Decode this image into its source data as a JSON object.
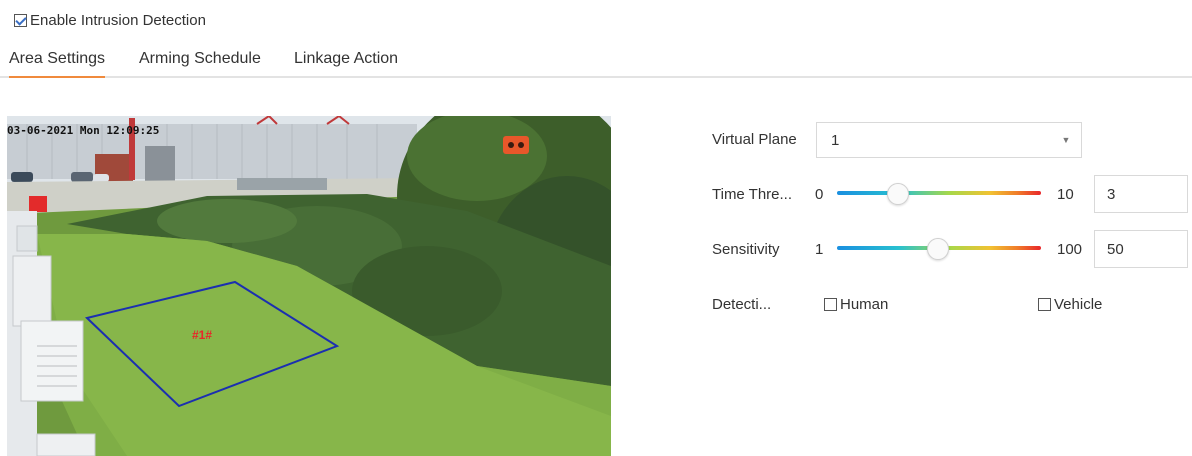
{
  "enable": {
    "label": "Enable Intrusion Detection",
    "checked": true
  },
  "tabs": [
    {
      "label": "Area Settings",
      "active": true
    },
    {
      "label": "Arming Schedule",
      "active": false
    },
    {
      "label": "Linkage Action",
      "active": false
    }
  ],
  "preview": {
    "osd_text": "03-06-2021 Mon 12:09:25",
    "zone_label": "#1#"
  },
  "settings": {
    "virtual_plane": {
      "label": "Virtual Plane",
      "value": "1"
    },
    "time_threshold": {
      "label": "Time Thre...",
      "min": "0",
      "max": "10",
      "value": "3"
    },
    "sensitivity": {
      "label": "Sensitivity",
      "min": "1",
      "max": "100",
      "value": "50"
    },
    "detection_target": {
      "label": "Detecti...",
      "options": [
        {
          "label": "Human",
          "checked": false
        },
        {
          "label": "Vehicle",
          "checked": false
        }
      ]
    }
  },
  "colors": {
    "accent_tab": "#f08a3c",
    "zone_outline": "#1b2fb0",
    "zone_label": "#e8262a"
  }
}
